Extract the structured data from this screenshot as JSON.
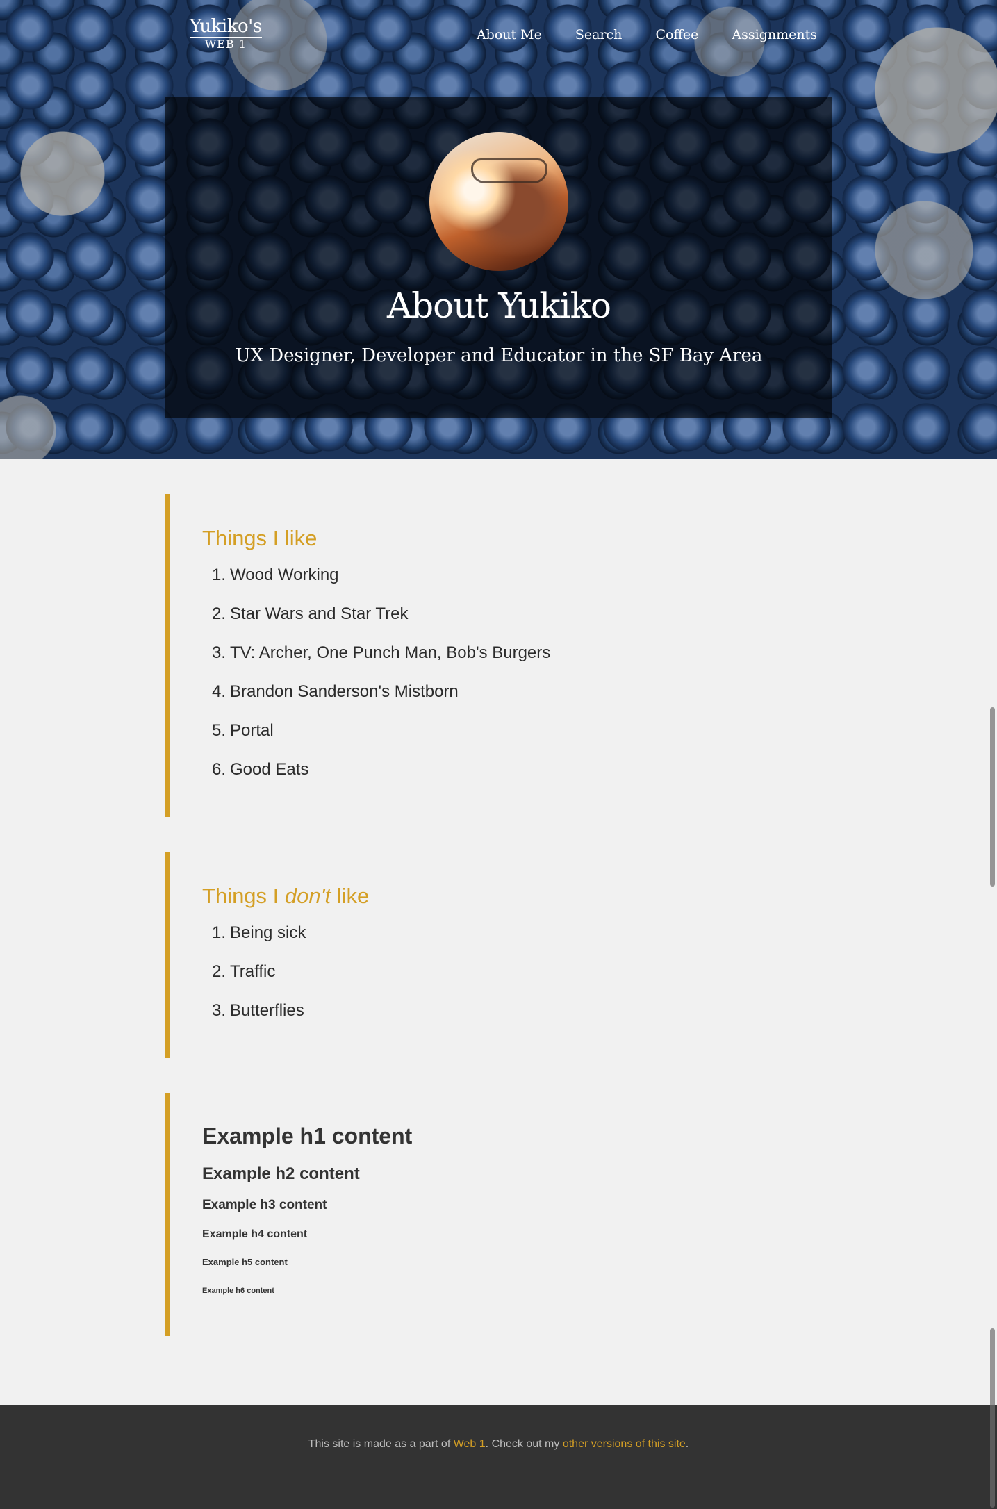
{
  "nav": {
    "brand_main": "Yukiko's",
    "brand_sub": "WEB 1",
    "links": [
      "About Me",
      "Search",
      "Coffee",
      "Assignments"
    ]
  },
  "hero": {
    "title": "About Yukiko",
    "subtitle": "UX Designer, Developer and Educator in the SF Bay Area"
  },
  "likes": {
    "heading": "Things I like",
    "items": [
      "Wood Working",
      "Star Wars and Star Trek",
      "TV: Archer, One Punch Man, Bob's Burgers",
      "Brandon Sanderson's Mistborn",
      "Portal",
      "Good Eats"
    ]
  },
  "dislikes": {
    "heading_prefix": "Things I ",
    "heading_emphasis": "don't",
    "heading_suffix": " like",
    "items": [
      "Being sick",
      "Traffic",
      "Butterflies"
    ]
  },
  "samples": {
    "h1": "Example h1 content",
    "h2": "Example h2 content",
    "h3": "Example h3 content",
    "h4": "Example h4 content",
    "h5": "Example h5 content",
    "h6": "Example h6 content"
  },
  "footer": {
    "text_1": "This site is made as a part of ",
    "link_1": "Web 1",
    "text_2": ". Check out my ",
    "link_2": "other versions of this site",
    "text_3": "."
  },
  "colors": {
    "accent": "#d49f25",
    "page_bg": "#f1f1f1",
    "footer_bg": "#333333"
  }
}
